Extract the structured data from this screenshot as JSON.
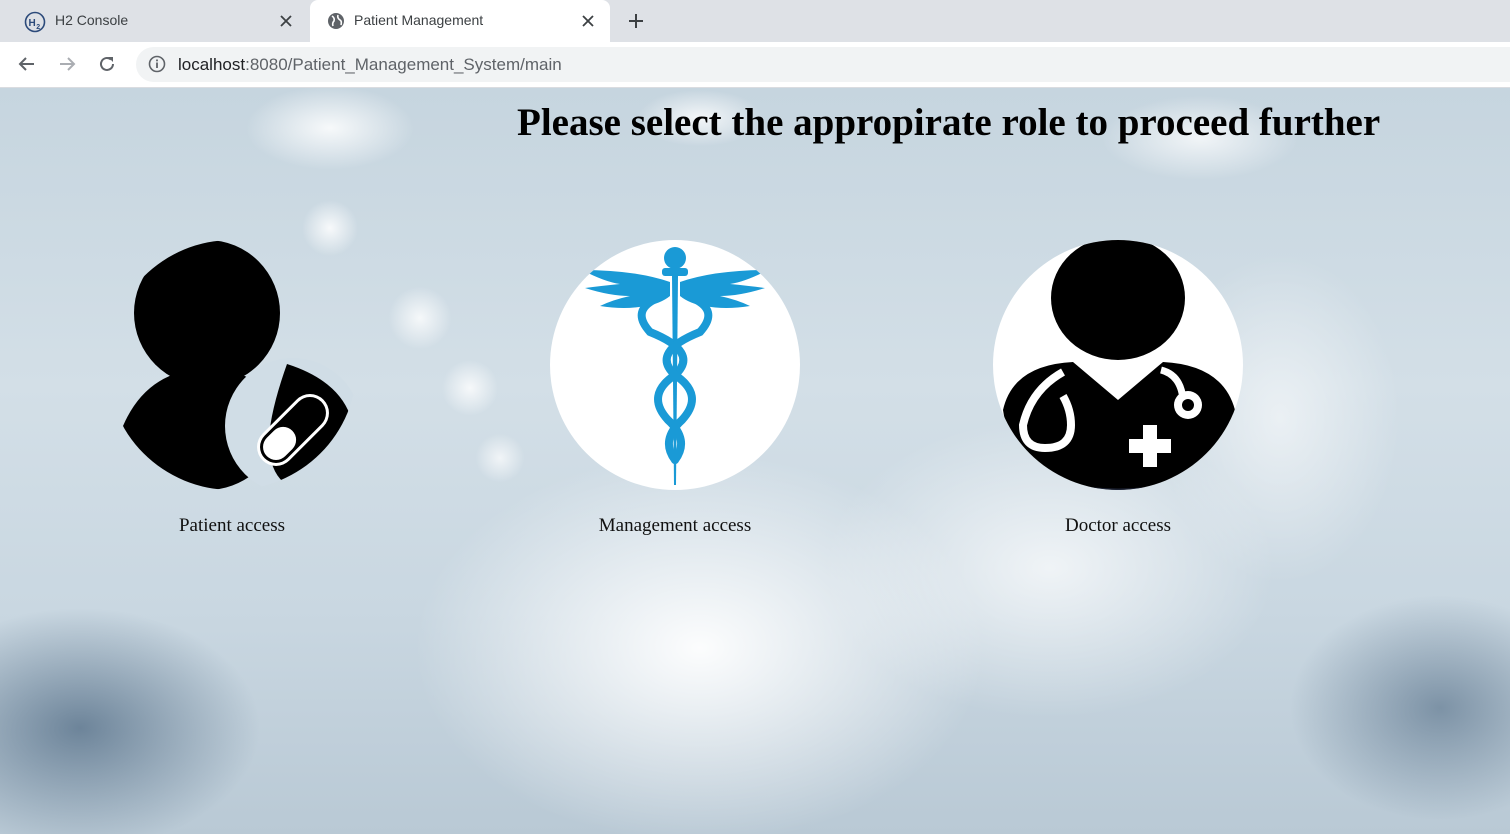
{
  "browser": {
    "tabs": [
      {
        "title": "H2 Console",
        "favicon": "h2-logo-icon",
        "active": false
      },
      {
        "title": "Patient Management",
        "favicon": "globe-icon",
        "active": true
      }
    ],
    "address": {
      "host": "localhost",
      "path": ":8080/Patient_Management_System/main"
    }
  },
  "page": {
    "heading": "Please select the appropirate role to proceed further",
    "roles": [
      {
        "label": "Patient access",
        "icon": "patient-pill-icon"
      },
      {
        "label": "Management access",
        "icon": "caduceus-icon",
        "accent": "#1a9ad6"
      },
      {
        "label": "Doctor access",
        "icon": "doctor-stethoscope-icon"
      }
    ]
  }
}
